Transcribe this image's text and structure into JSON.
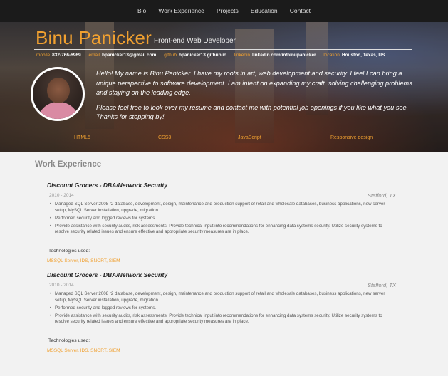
{
  "nav": {
    "items": [
      "Bio",
      "Work Experience",
      "Projects",
      "Education",
      "Contact"
    ]
  },
  "header": {
    "name": "Binu Panicker",
    "role": "Front-end Web Developer",
    "contacts": [
      {
        "label": "mobile",
        "value": "832-766-6969"
      },
      {
        "label": "email",
        "value": "bpanicker13@gmail.com"
      },
      {
        "label": "github",
        "value": "bpanicker13.github.io"
      },
      {
        "label": "linkedin",
        "value": "linkedin.com/in/binupanicker"
      },
      {
        "label": "location",
        "value": "Houston, Texas, US"
      }
    ],
    "bio": [
      "Hello! My name is Binu Panicker. I have my roots in art, web development and security. I feel I can bring a unique perspective to software development. I am intent on expanding my craft, solving challenging problems and staying on the leading edge.",
      "Please feel free to look over my resume and contact me with potential job openings if you like what you see. Thanks for stopping by!"
    ],
    "skills": [
      "HTML5",
      "CSS3",
      "JavaScript",
      "Responsive design"
    ]
  },
  "work": {
    "title": "Work Experience",
    "jobs": [
      {
        "title": "Discount Grocers - DBA/Network Security",
        "dates": "2010 - 2014",
        "location": "Stafford, TX",
        "bullets": [
          "Managed SQL Server 2008 r2 database, development, design, maintenance and production support of retail and wholesale databases, business applications, new server setup, MySQL Server installation, upgrade, migration.",
          "Performed security and logged reviews for systems.",
          "Provide assistance with security audits, risk assessments. Provide technical input into recommendations for enhancing data systems security. Utilize security systems to resolve security related issues and ensure effective and appropriate security measures are in place."
        ],
        "tech_label": "Technologies used:",
        "tech": "MSSQL Server, IDS, SNORT, SIEM"
      },
      {
        "title": "Discount Grocers - DBA/Network Security",
        "dates": "2010 - 2014",
        "location": "Stafford, TX",
        "bullets": [
          "Managed SQL Server 2008 r2 database, development, design, maintenance and production support of retail and wholesale databases, business applications, new server setup, MySQL Server installation, upgrade, migration.",
          "Performed security and logged reviews for systems.",
          "Provide assistance with security audits, risk assessments. Provide technical input into recommendations for enhancing data systems security. Utilize security systems to resolve security related issues and ensure effective and appropriate security measures are in place."
        ],
        "tech_label": "Technologies used:",
        "tech": "MSSQL Server, IDS, SNORT, SIEM"
      }
    ]
  },
  "colors": {
    "accent": "#f0a030",
    "navbar": "#1b1b1b",
    "page_bg": "#f2f2f2"
  }
}
